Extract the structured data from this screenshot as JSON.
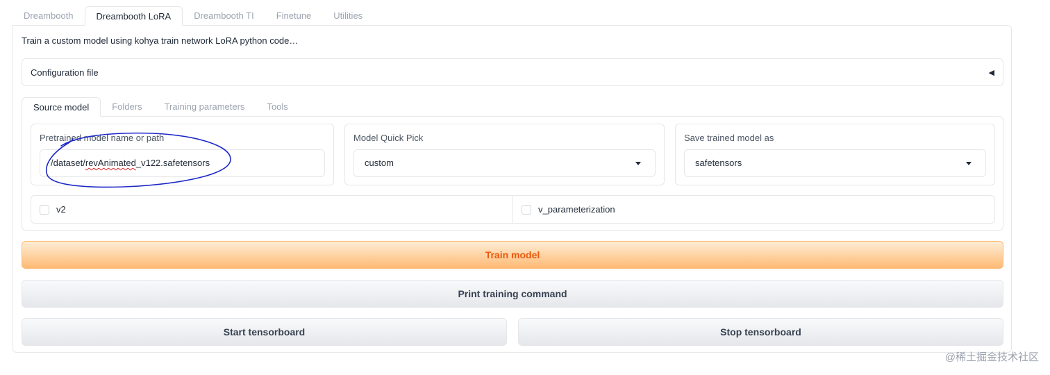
{
  "top_tabs": [
    "Dreambooth",
    "Dreambooth LoRA",
    "Dreambooth TI",
    "Finetune",
    "Utilities"
  ],
  "description": "Train a custom model using kohya train network LoRA python code…",
  "config_accordion": {
    "label": "Configuration file",
    "caret": "◀"
  },
  "inner_tabs": [
    "Source model",
    "Folders",
    "Training parameters",
    "Tools"
  ],
  "pretrained": {
    "label": "Pretrained model name or path",
    "value_prefix": "/dataset/",
    "value_underlined": "revAnimated",
    "value_suffix": "_v122.safetensors"
  },
  "quick_pick": {
    "label": "Model Quick Pick",
    "value": "custom"
  },
  "save_as": {
    "label": "Save trained model as",
    "value": "safetensors"
  },
  "checkboxes": {
    "v2": "v2",
    "v_param": "v_parameterization"
  },
  "buttons": {
    "train": "Train model",
    "print_cmd": "Print training command",
    "start_tb": "Start tensorboard",
    "stop_tb": "Stop tensorboard"
  },
  "watermark": "@稀土掘金技术社区",
  "colors": {
    "accent": "#ea580c",
    "annotation_ink": "#1d28c8"
  }
}
